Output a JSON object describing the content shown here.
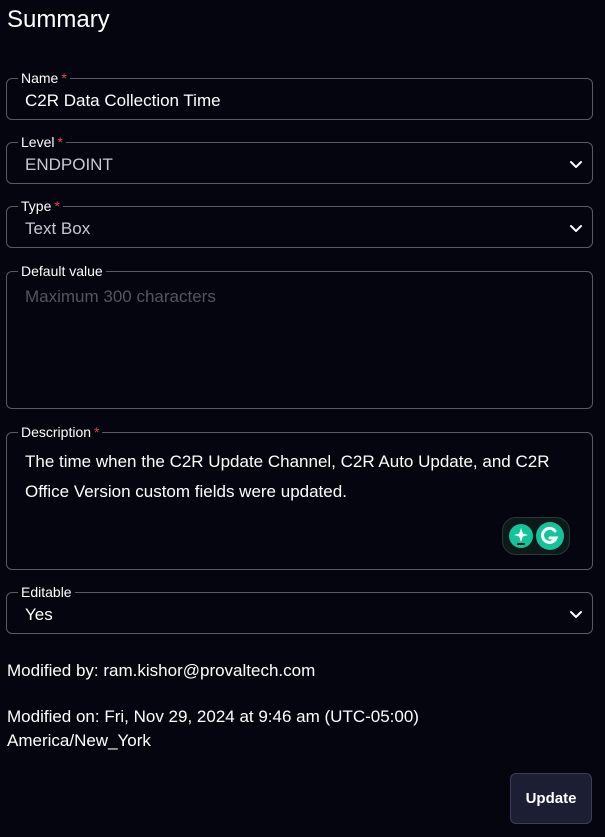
{
  "page": {
    "title": "Summary"
  },
  "form": {
    "name": {
      "label": "Name",
      "required_mark": "*",
      "value": "C2R Data Collection Time"
    },
    "level": {
      "label": "Level",
      "required_mark": "*",
      "value": "ENDPOINT"
    },
    "type": {
      "label": "Type",
      "required_mark": "*",
      "value": "Text Box"
    },
    "default_value": {
      "label": "Default value",
      "placeholder": "Maximum 300 characters"
    },
    "description": {
      "label": "Description",
      "required_mark": "*",
      "value": "The time when the C2R Update Channel, C2R Auto Update, and C2R Office Version custom fields were updated."
    },
    "editable": {
      "label": "Editable",
      "value": "Yes"
    }
  },
  "meta": {
    "modified_by": "Modified by: ram.kishor@provaltech.com",
    "modified_on": "Modified on: Fri, Nov 29, 2024 at 9:46 am (UTC-05:00)",
    "timezone": "America/New_York"
  },
  "actions": {
    "update_label": "Update"
  },
  "icons": {
    "chevron": "chevron-down-icon",
    "grammarly_assist": "grammarly-assistant-icon",
    "grammarly_logo": "grammarly-logo-icon"
  },
  "colors": {
    "background": "#05050f",
    "border": "#5a5a66",
    "required": "#e5484d",
    "button_bg": "#1c1f33",
    "grammarly_green": "#15c39a"
  }
}
